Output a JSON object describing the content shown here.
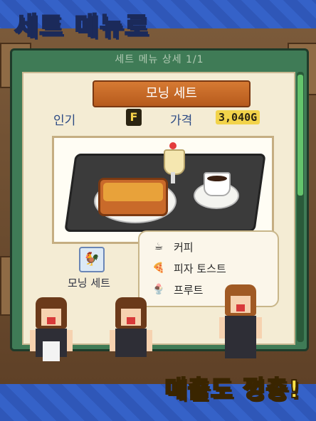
{
  "banner": {
    "title": "세트 메뉴로",
    "footer": "매출도 껑충!"
  },
  "panel": {
    "header": "세트 메뉴 상세 1/1",
    "set_name": "모닝 세트",
    "popularity_label": "인기",
    "popularity_rank": "F",
    "price_label": "가격",
    "price_value": "3,040G",
    "set_caption": "모닝 세트",
    "set_icon": "rooster-icon"
  },
  "items": [
    {
      "icon": "coffee-cup-icon",
      "name": "커피"
    },
    {
      "icon": "pizza-toast-icon",
      "name": "피자 토스트"
    },
    {
      "icon": "parfait-icon",
      "name": "프루트"
    }
  ],
  "colors": {
    "accent_orange": "#c8692a",
    "panel_green": "#3f7b56",
    "banner_yellow": "#ffe34a",
    "background_blue": "#3562c8"
  }
}
